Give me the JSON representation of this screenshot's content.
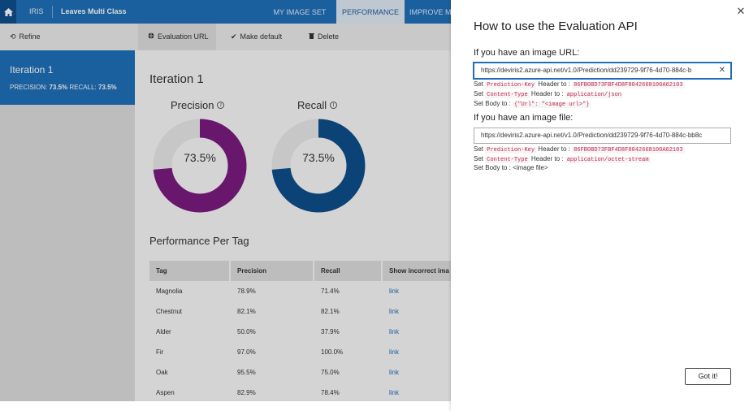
{
  "topbar": {
    "brand": "IRIS",
    "project": "Leaves Multi Class",
    "tabs": [
      "MY IMAGE SET",
      "PERFORMANCE",
      "IMPROVE M"
    ]
  },
  "commands": {
    "refine": "Refine",
    "eval_url": "Evaluation URL",
    "make_default": "Make default",
    "delete": "Delete"
  },
  "sidebar": {
    "iteration_name": "Iteration 1",
    "precision_label": "PRECISION:",
    "precision_value": "73.5%",
    "recall_label": "RECALL:",
    "recall_value": "73.5%"
  },
  "main": {
    "title": "Iteration 1",
    "precision_label": "Precision",
    "precision_value": "73.5%",
    "precision_fraction": 0.735,
    "recall_label": "Recall",
    "recall_value": "73.5%",
    "recall_fraction": 0.735,
    "per_tag_title": "Performance Per Tag",
    "table": {
      "headers": [
        "Tag",
        "Precision",
        "Recall",
        "Show incorrect ima"
      ],
      "rows": [
        [
          "Magnolia",
          "78.9%",
          "71.4%",
          "link"
        ],
        [
          "Chestnut",
          "82.1%",
          "82.1%",
          "link"
        ],
        [
          "Alder",
          "50.0%",
          "37.9%",
          "link"
        ],
        [
          "Fir",
          "97.0%",
          "100.0%",
          "link"
        ],
        [
          "Oak",
          "95.5%",
          "75.0%",
          "link"
        ],
        [
          "Aspen",
          "82.9%",
          "78.4%",
          "link"
        ]
      ]
    }
  },
  "colors": {
    "primary": "#1f6fb8",
    "precision_ring": "#7b1a7f",
    "recall_ring": "#0d4f8b",
    "code": "#c7254e"
  },
  "panel": {
    "title": "How to use the Evaluation API",
    "url_section": {
      "heading": "If you have an image URL:",
      "endpoint": "https://deviris2.azure-api.net/v1.0/Prediction/dd239729-9f76-4d70-884c-b",
      "set": "Set",
      "key_name": "Prediction-Key",
      "header_to": "Header to :",
      "key_value": "86FB0BD73FBF4D8F8042668100A62103",
      "content_type_name": "Content-Type",
      "content_type_value": "application/json",
      "body_label": "Set Body to :",
      "body_value": "{\"Url\": \"<image url>\"}"
    },
    "file_section": {
      "heading": "If you have an image file:",
      "endpoint": "https://deviris2.azure-api.net/v1.0/Prediction/dd239729-9f76-4d70-884c-bb8c",
      "set": "Set",
      "key_name": "Prediction-Key",
      "header_to": "Header to :",
      "key_value": "86FB0BD73FBF4D8F8042668100A62103",
      "content_type_name": "Content-Type",
      "content_type_value": "application/octet-stream",
      "body_label": "Set Body to :",
      "body_value": "<image file>"
    },
    "button": "Got it!"
  }
}
